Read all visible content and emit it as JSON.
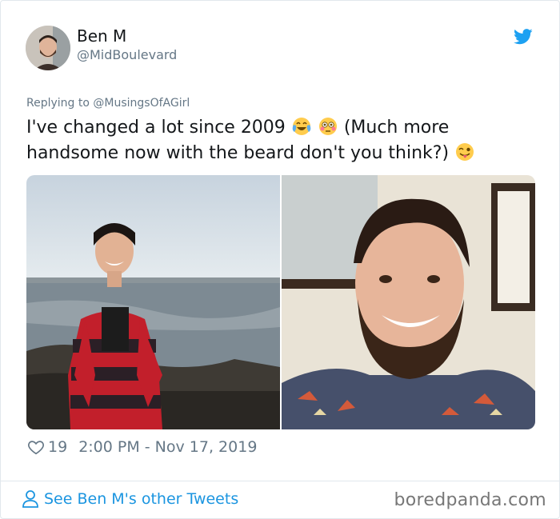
{
  "author": {
    "name": "Ben M",
    "handle": "@MidBoulevard"
  },
  "tweet": {
    "reply_prefix": "Replying to",
    "reply_to": "@MusingsOfAGirl",
    "text_part1": "I've changed a lot since 2009",
    "text_part2": "(Much more handsome now with the beard don't you think?)",
    "emojis": [
      "face-with-tears-of-joy",
      "flushed-face",
      "winking-face-with-tongue"
    ]
  },
  "media": {
    "photos": [
      "photo-2009-coast",
      "photo-now-beard"
    ]
  },
  "meta": {
    "likes": "19",
    "timestamp": "2:00 PM - Nov 17, 2019"
  },
  "footer": {
    "see_more": "See Ben M's other Tweets",
    "watermark": "boredpanda.com"
  },
  "colors": {
    "twitter_blue": "#1da1f2",
    "link_blue": "#1b95e0",
    "muted": "#657786"
  }
}
